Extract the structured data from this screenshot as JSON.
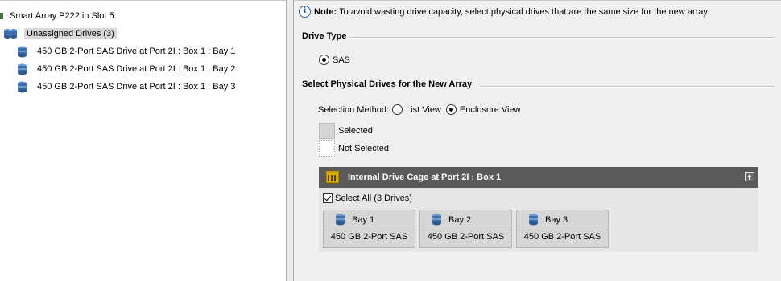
{
  "tree": {
    "controller": "Smart Array P222 in Slot 5",
    "group": "Unassigned Drives (3)",
    "drives": [
      "450 GB 2-Port SAS Drive at Port 2I : Box 1 : Bay 1",
      "450 GB 2-Port SAS Drive at Port 2I : Box 1 : Bay 2",
      "450 GB 2-Port SAS Drive at Port 2I : Box 1 : Bay 3"
    ]
  },
  "note": {
    "bold": "Note:",
    "text": "To avoid wasting drive capacity, select physical drives that are the same size for the new array."
  },
  "drive_type": {
    "title": "Drive Type",
    "option": "SAS",
    "selected": true
  },
  "select_drives": {
    "title": "Select Physical Drives for the New Array",
    "method_label": "Selection Method:",
    "methods": [
      "List View",
      "Enclosure View"
    ],
    "selected_method": "Enclosure View",
    "legend_selected": "Selected",
    "legend_not_selected": "Not Selected"
  },
  "cage": {
    "title": "Internal Drive Cage at Port 2I : Box 1",
    "select_all": "Select All (3 Drives)",
    "select_all_checked": true,
    "bays": [
      {
        "label": "Bay 1",
        "capacity": "450 GB 2-Port SAS"
      },
      {
        "label": "Bay 2",
        "capacity": "450 GB 2-Port SAS"
      },
      {
        "label": "Bay 3",
        "capacity": "450 GB 2-Port SAS"
      }
    ]
  },
  "colors": {
    "header_bg": "#5a5a5a",
    "pane_bg": "#f0f0f0",
    "selected_bg": "#d6d6d6",
    "drive_icon": "#3d6fb0"
  }
}
